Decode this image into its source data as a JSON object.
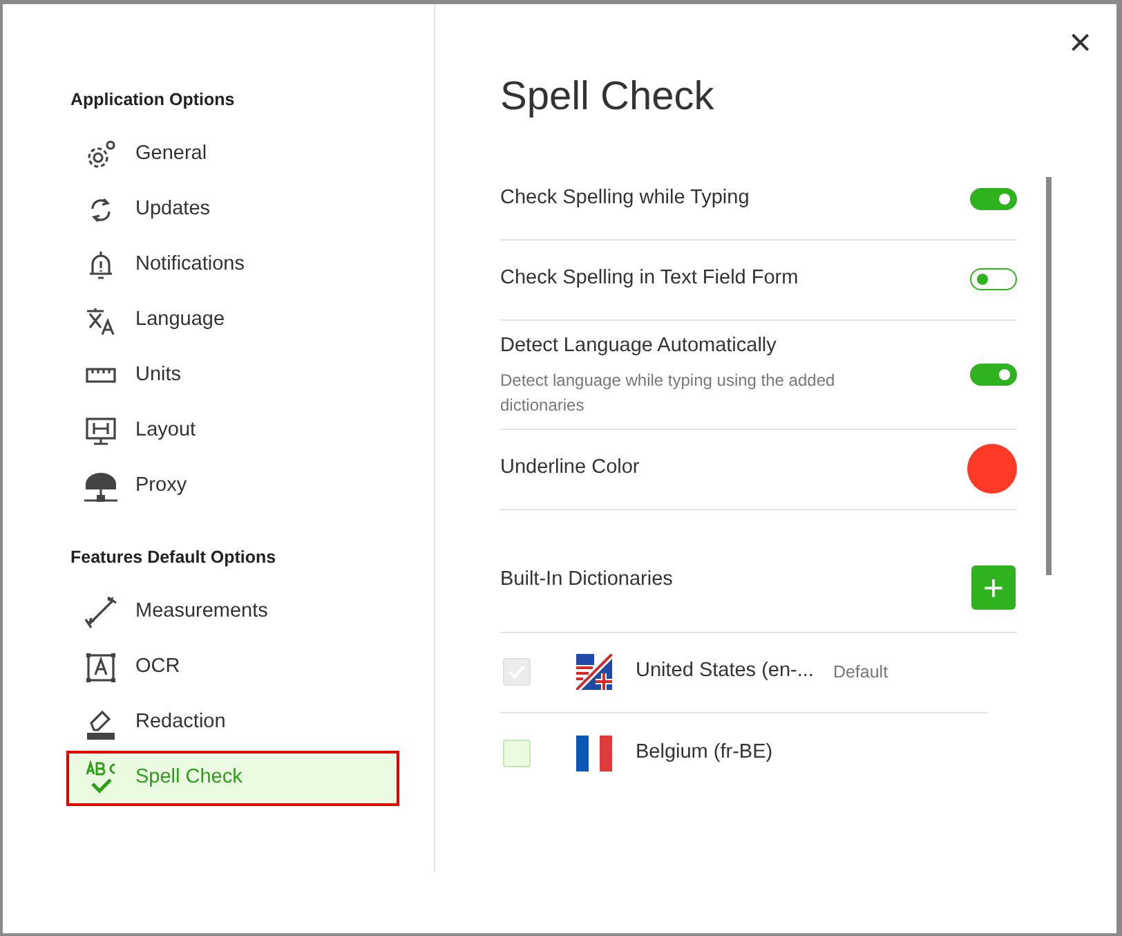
{
  "close_button": "×",
  "sidebar": {
    "sections": [
      {
        "title": "Application Options",
        "items": [
          {
            "label": "General",
            "selected": false
          },
          {
            "label": "Updates",
            "selected": false
          },
          {
            "label": "Notifications",
            "selected": false
          },
          {
            "label": "Language",
            "selected": false
          },
          {
            "label": "Units",
            "selected": false
          },
          {
            "label": "Layout",
            "selected": false
          },
          {
            "label": "Proxy",
            "selected": false
          }
        ]
      },
      {
        "title": "Features Default Options",
        "items": [
          {
            "label": "Measurements",
            "selected": false
          },
          {
            "label": "OCR",
            "selected": false
          },
          {
            "label": "Redaction",
            "selected": false
          },
          {
            "label": "Spell Check",
            "selected": true
          }
        ]
      }
    ]
  },
  "content": {
    "title": "Spell Check",
    "settings": [
      {
        "kind": "toggle",
        "label": "Check Spelling while Typing",
        "on": true
      },
      {
        "kind": "toggle",
        "label": "Check Spelling in Text Field Form",
        "on": false
      },
      {
        "kind": "toggle",
        "label": "Detect Language Automatically",
        "description": "Detect language while typing using the added dictionaries",
        "on": true
      },
      {
        "kind": "color",
        "label": "Underline Color",
        "color": "#ff3b27"
      }
    ],
    "dictionaries": {
      "title": "Built-In Dictionaries",
      "add_button": "+",
      "items": [
        {
          "name": "United States (en-...",
          "checked": true,
          "disabled": true,
          "tag": "Default"
        },
        {
          "name": "Belgium (fr-BE)",
          "checked": false,
          "disabled": false
        }
      ]
    }
  }
}
